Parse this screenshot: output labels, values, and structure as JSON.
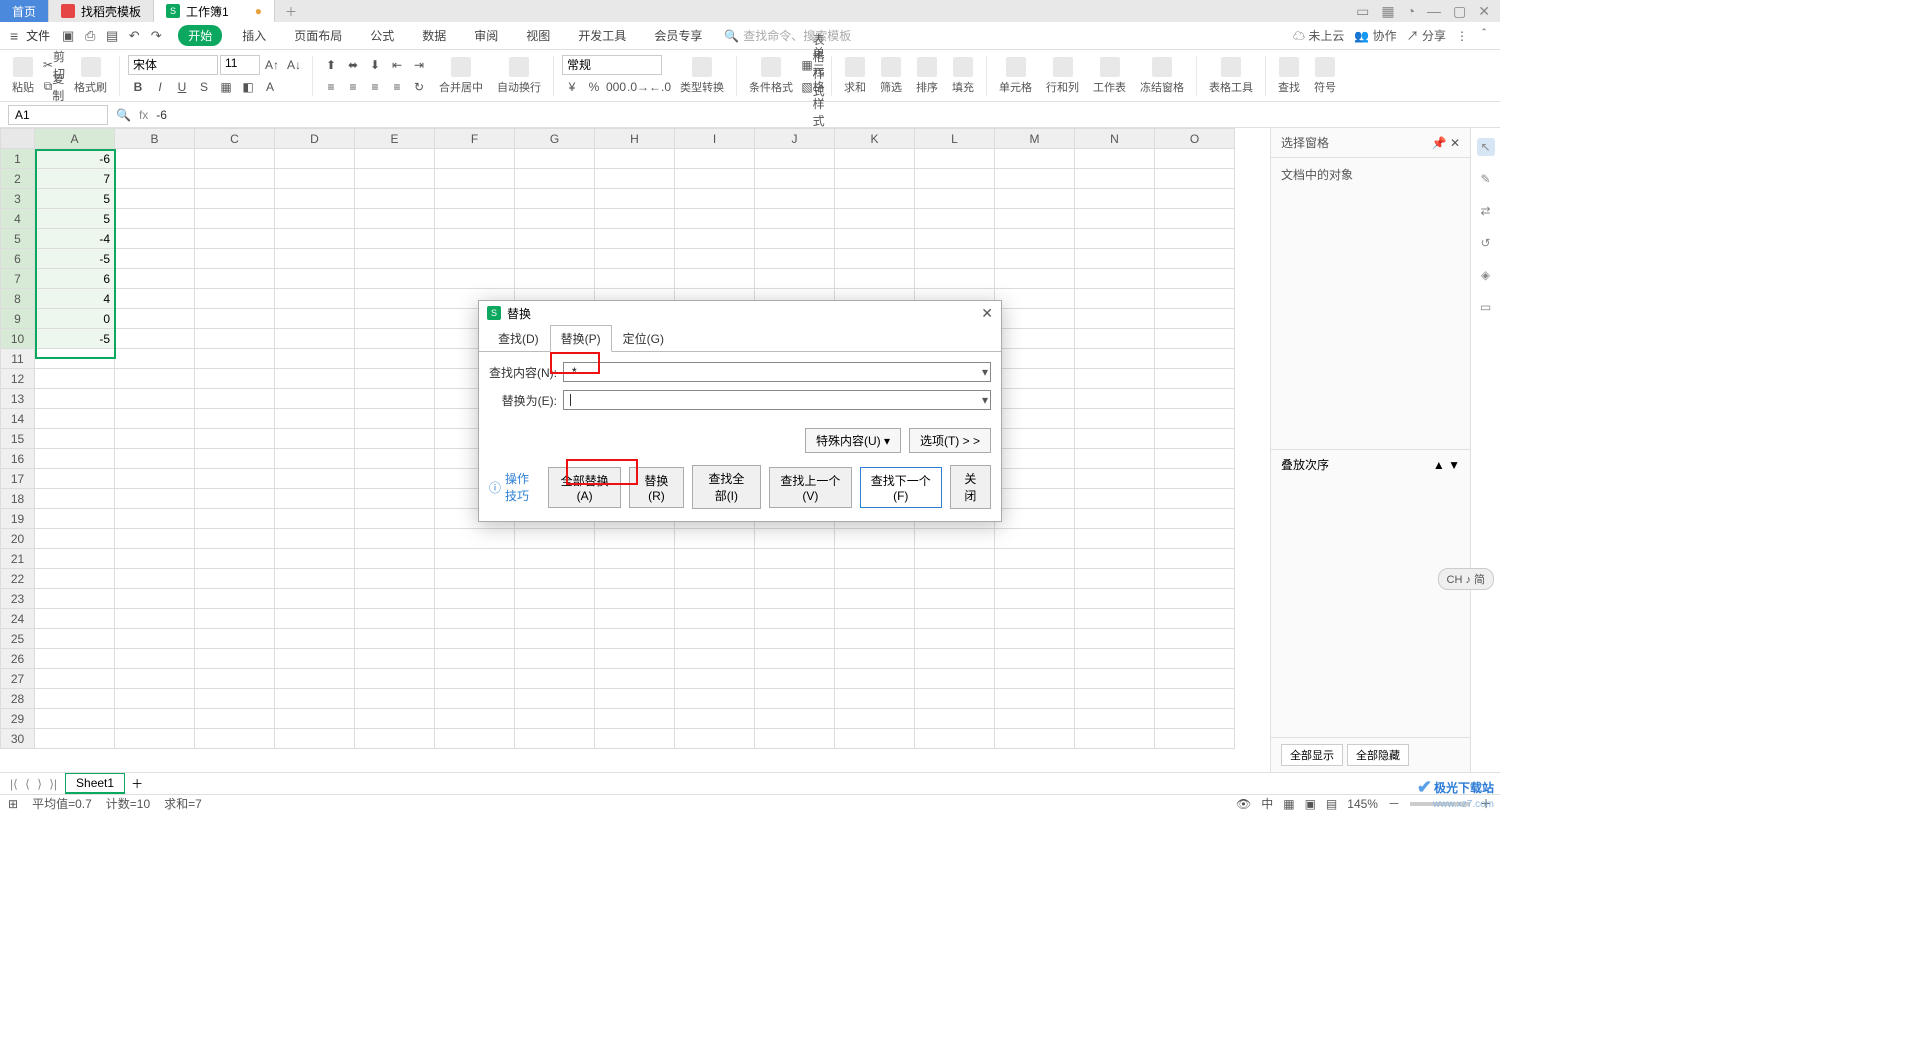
{
  "titlebar": {
    "tabs": [
      {
        "label": "首页"
      },
      {
        "label": "找稻壳模板"
      },
      {
        "label": "工作簿1"
      }
    ],
    "unsaved_marker": "●"
  },
  "menubar": {
    "file": "文件",
    "tabs": [
      "开始",
      "插入",
      "页面布局",
      "公式",
      "数据",
      "审阅",
      "视图",
      "开发工具",
      "会员专享"
    ],
    "search_placeholder": "查找命令、搜索模板",
    "right": {
      "cloud": "未上云",
      "collab": "协作",
      "share": "分享"
    }
  },
  "ribbon": {
    "paste": "粘贴",
    "cut": "剪切",
    "copy": "复制",
    "format_painter": "格式刷",
    "font_name": "宋体",
    "font_size": "11",
    "number_format": "常规",
    "merge_center": "合并居中",
    "wrap": "自动换行",
    "type_convert": "类型转换",
    "cond_format": "条件格式",
    "cell_format": "单元格样式",
    "table_style": "表格样式",
    "sum": "求和",
    "filter": "筛选",
    "sort": "排序",
    "fill": "填充",
    "cell": "单元格",
    "rowcol": "行和列",
    "sheet": "工作表",
    "freeze": "冻结窗格",
    "table_tools": "表格工具",
    "find": "查找",
    "symbol": "符号"
  },
  "formulabar": {
    "cellref": "A1",
    "fx": "fx",
    "formula": "-6"
  },
  "grid": {
    "cols": [
      "A",
      "B",
      "C",
      "D",
      "E",
      "F",
      "G",
      "H",
      "I",
      "J",
      "K",
      "L",
      "M",
      "N",
      "O"
    ],
    "rows": 30,
    "data": {
      "A": [
        "-6",
        "7",
        "5",
        "5",
        "-4",
        "-5",
        "6",
        "4",
        "0",
        "-5"
      ]
    },
    "selected_col": "A",
    "selected_rows_from": 1,
    "selected_rows_to": 10,
    "active_cell": "A1"
  },
  "rightpanel": {
    "title": "选择窗格",
    "section": "文档中的对象",
    "order": "叠放次序",
    "show_all": "全部显示",
    "hide_all": "全部隐藏"
  },
  "dialog": {
    "title": "替换",
    "tabs": {
      "find": "查找(D)",
      "replace": "替换(P)",
      "goto": "定位(G)"
    },
    "find_label": "查找内容(N):",
    "find_value": "-*",
    "replace_label": "替换为(E):",
    "replace_value": "",
    "special": "特殊内容(U)",
    "options": "选项(T) > >",
    "tip": "操作技巧",
    "btn_replace_all": "全部替换(A)",
    "btn_replace": "替换(R)",
    "btn_find_all": "查找全部(I)",
    "btn_find_prev": "查找上一个(V)",
    "btn_find_next": "查找下一个(F)",
    "btn_close": "关闭"
  },
  "sheetbar": {
    "sheet": "Sheet1"
  },
  "statusbar": {
    "avg": "平均值=0.7",
    "count": "计数=10",
    "sum": "求和=7",
    "zoom": "145%"
  },
  "floatch": "CH ♪ 简",
  "watermark": {
    "name": "极光下载站",
    "url": "www.xz7.com"
  },
  "chart_data": null
}
